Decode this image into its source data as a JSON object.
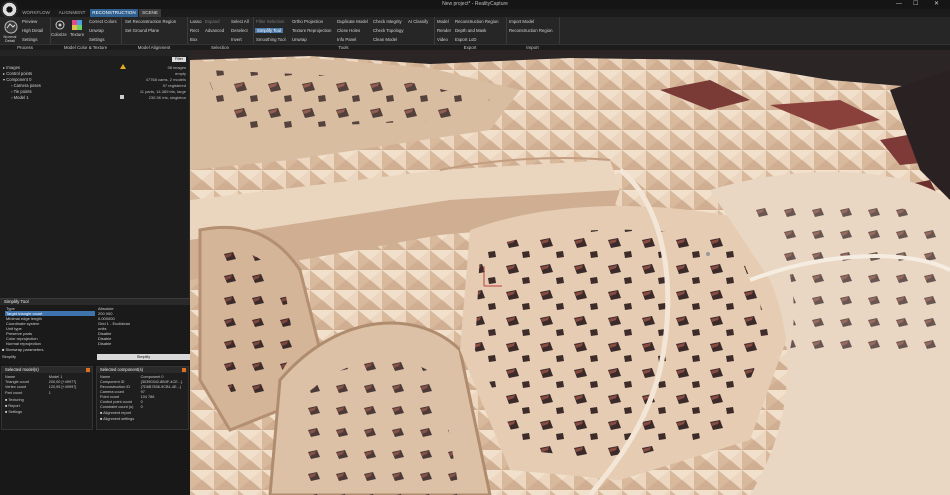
{
  "window": {
    "title": "New project* - RealityCapture",
    "minimize": "—",
    "maximize": "☐",
    "close": "✕"
  },
  "tabs": [
    {
      "label": "WORKFLOW"
    },
    {
      "label": "ALIGNMENT"
    },
    {
      "label": "RECONSTRUCTION"
    },
    {
      "label": "SCENE"
    }
  ],
  "ribbon": {
    "process": {
      "big_button": "Normal Detail",
      "items": [
        "Preview",
        "High Detail",
        "Settings"
      ]
    },
    "model_color_texture": {
      "colorize": "Colorize",
      "texture": "Texture",
      "items": [
        "Correct Colors",
        "Unwrap",
        "Settings"
      ]
    },
    "model_alignment": {
      "items": [
        "Set Reconstruction Region",
        "Set Ground Plane"
      ]
    },
    "selection": {
      "col1": [
        "Lasso",
        "Rect",
        "Box"
      ],
      "col2": [
        "Expand",
        "Advanced"
      ],
      "col3": [
        "Select All",
        "Deselect",
        "Invert"
      ]
    },
    "tools": {
      "col1": [
        "Filter Selection",
        "Simplify Tool",
        "Smoothing Tool"
      ],
      "col2": [
        "Ortho Projection",
        "Texture Reprojection",
        "Unwrap"
      ],
      "col3": [
        "Duplicate Model",
        "Close Holes",
        "Info Panel"
      ],
      "col4": [
        "Check Integrity",
        "Check Topology",
        "Clean Model"
      ],
      "col5": [
        "AI Classify"
      ]
    },
    "export": {
      "col1": [
        "Model",
        "Render",
        "Video"
      ],
      "col2": [
        "Reconstruction Region",
        "Depth and Mask",
        "Export LoD"
      ]
    },
    "import": {
      "items": [
        "Import Model",
        "Reconstruction Region"
      ]
    },
    "groups": [
      "Process",
      "Model Color & Texture",
      "Model Alignment",
      "Selection",
      "Tools",
      "Export",
      "Import"
    ]
  },
  "project_tree": {
    "filter_label": "Filter",
    "items": [
      {
        "label": "Images",
        "value": "98 images"
      },
      {
        "label": "Control points",
        "value": "empty"
      },
      {
        "label": "Component 0",
        "value": "47768 cams, 2 models"
      },
      {
        "label": "Camera poses",
        "value": "97 registered"
      },
      {
        "label": "Tie points",
        "value": "11 parts, 14,389 tris, large"
      },
      {
        "label": "Model 1",
        "value": "230.3K tris, singleton"
      }
    ]
  },
  "simplify_tool": {
    "title": "Simplify Tool",
    "rows": [
      {
        "k": "Type",
        "v": "Absolute"
      },
      {
        "k": "Target triangle count",
        "v": "200 000"
      },
      {
        "k": "Minimal edge length",
        "v": "0.000000"
      },
      {
        "k": "Coordinate system",
        "v": "Grid 1 - Euclidean"
      },
      {
        "k": "Unit type",
        "v": "units"
      },
      {
        "k": "Preserve parts",
        "v": "Disable"
      },
      {
        "k": "Color reprojection",
        "v": "Disable"
      },
      {
        "k": "Normal reprojection",
        "v": "Disable"
      }
    ],
    "section": "Sinewrap parameters",
    "simplify_label": "Simplify",
    "simplify_button": "Simplify"
  },
  "selected_model": {
    "title": "Selected model(s)",
    "rows": [
      {
        "k": "Name",
        "v": "Model 1"
      },
      {
        "k": "Triangle count",
        "v": "200,00 [+49977]"
      },
      {
        "k": "Vertex count",
        "v": "120,95 [+49997]"
      },
      {
        "k": "Part count",
        "v": "1"
      }
    ],
    "sections": [
      "Texturing",
      "Report",
      "Settings"
    ]
  },
  "selected_component": {
    "title": "Selected component(s)",
    "rows": [
      {
        "k": "Name",
        "v": "Component 0"
      },
      {
        "k": "Component ID",
        "v": "{30390342-8B4F-4CE...}"
      },
      {
        "k": "Reconstruction ID",
        "v": "{7D6B7836-9CB1-4E...}"
      },
      {
        "k": "Camera count",
        "v": "97"
      },
      {
        "k": "Point count",
        "v": "104 786"
      },
      {
        "k": "Control point count",
        "v": "0"
      },
      {
        "k": "Constraint count (u)",
        "v": "0"
      }
    ],
    "sections": [
      "Alignment report",
      "Alignment settings"
    ]
  },
  "colors": {
    "accent": "#2f5f8f",
    "selection": "#3e73ad",
    "mesh_light": "#e6ccb3",
    "mesh_shadow": "#7a4a42"
  }
}
